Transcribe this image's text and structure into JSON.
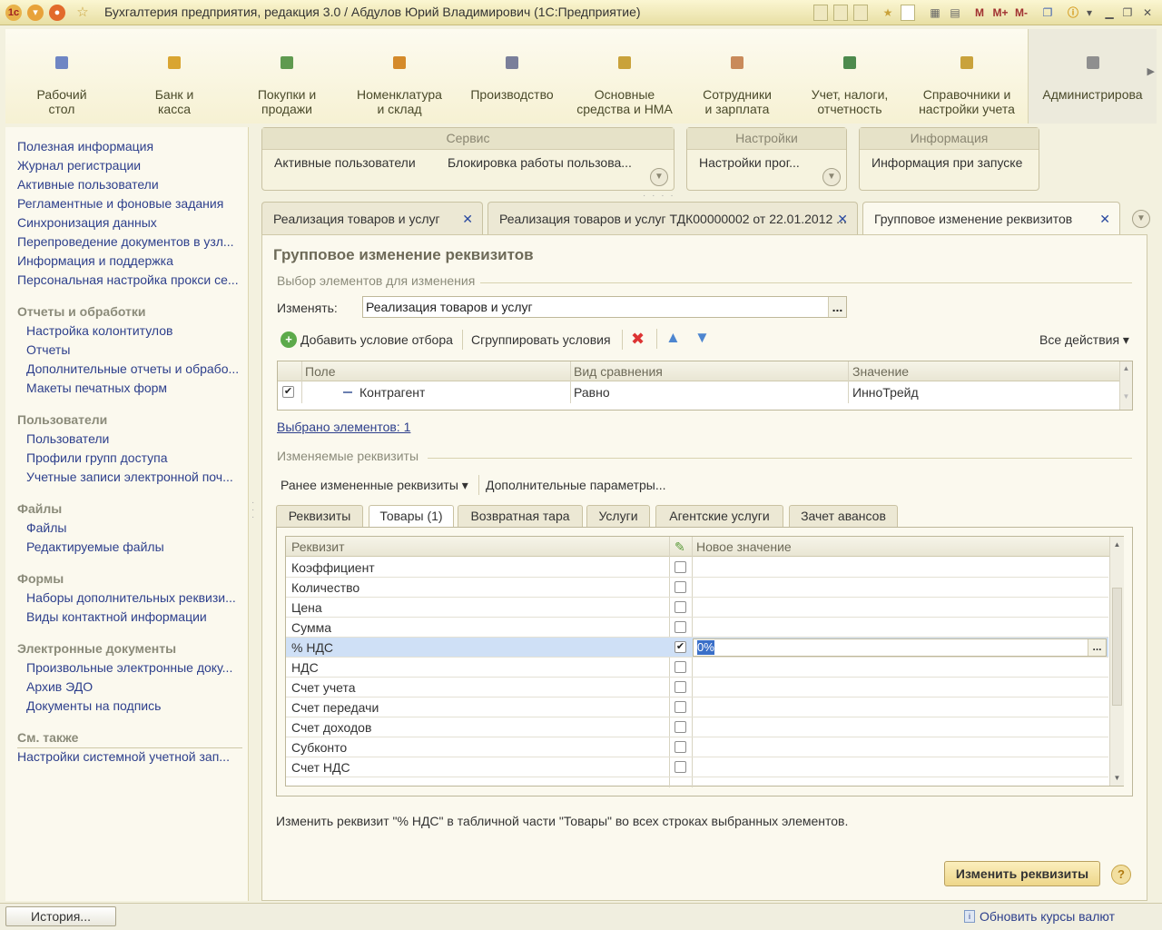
{
  "window": {
    "title": "Бухгалтерия предприятия, редакция 3.0 / Абдулов Юрий Владимирович  (1С:Предприятие)",
    "toolbar_buttons": [
      "M",
      "M+",
      "M-"
    ]
  },
  "sections": [
    {
      "label1": "Рабочий",
      "label2": "стол",
      "icon": "desktop-icon",
      "color": "#6f86c4"
    },
    {
      "label1": "Банк и",
      "label2": "касса",
      "icon": "bank-icon",
      "color": "#d9a531"
    },
    {
      "label1": "Покупки и",
      "label2": "продажи",
      "icon": "cart-icon",
      "color": "#5f9a4f"
    },
    {
      "label1": "Номенклатура",
      "label2": "и склад",
      "icon": "warehouse-icon",
      "color": "#d48a2a"
    },
    {
      "label1": "Производство",
      "label2": "",
      "icon": "factory-icon",
      "color": "#7a7f9a"
    },
    {
      "label1": "Основные",
      "label2": "средства и НМА",
      "icon": "truck-icon",
      "color": "#c9a23b"
    },
    {
      "label1": "Сотрудники",
      "label2": "и зарплата",
      "icon": "people-icon",
      "color": "#c98a5a"
    },
    {
      "label1": "Учет, налоги,",
      "label2": "отчетность",
      "icon": "ledger-icon",
      "color": "#4d8a4d"
    },
    {
      "label1": "Справочники и",
      "label2": "настройки учета",
      "icon": "book-icon",
      "color": "#c9a23b"
    },
    {
      "label1": "Администрирова",
      "label2": "",
      "icon": "gear-icon",
      "color": "#8f8f8f"
    }
  ],
  "left_panel": {
    "links_top": [
      "Полезная информация",
      "Журнал регистрации",
      "Активные пользователи",
      "Регламентные и фоновые задания",
      "Синхронизация данных",
      "Перепроведение документов в узл...",
      "Информация и поддержка",
      "Персональная настройка прокси се..."
    ],
    "groups": [
      {
        "title": "Отчеты и обработки",
        "items": [
          "Настройка колонтитулов",
          "Отчеты",
          "Дополнительные отчеты и обрабо...",
          "Макеты печатных форм"
        ]
      },
      {
        "title": "Пользователи",
        "items": [
          "Пользователи",
          "Профили групп доступа",
          "Учетные записи электронной поч..."
        ]
      },
      {
        "title": "Файлы",
        "items": [
          "Файлы",
          "Редактируемые файлы"
        ]
      },
      {
        "title": "Формы",
        "items": [
          "Наборы дополнительных реквизи...",
          "Виды контактной информации"
        ]
      },
      {
        "title": "Электронные документы",
        "items": [
          "Произвольные электронные доку...",
          "Архив ЭДО",
          "Документы на подпись"
        ]
      }
    ],
    "see_also": {
      "title": "См. также",
      "items": [
        "Настройки системной учетной зап..."
      ]
    }
  },
  "action_groups": [
    {
      "title": "Сервис",
      "items": [
        "Активные пользователи",
        "Блокировка работы пользова..."
      ]
    },
    {
      "title": "Настройки",
      "items": [
        "Настройки прог..."
      ]
    },
    {
      "title": "Информация",
      "items": [
        "Информация при запуске"
      ]
    }
  ],
  "tabs": [
    {
      "label": "Реализация товаров и услуг",
      "close": "✕"
    },
    {
      "label": "Реализация товаров и услуг ТДК00000002 от 22.01.2012 ...",
      "close": "✕"
    },
    {
      "label": "Групповое изменение реквизитов",
      "close": "✕"
    }
  ],
  "form": {
    "title": "Групповое изменение реквизитов",
    "selection_legend": "Выбор элементов для изменения",
    "change_label": "Изменять:",
    "change_value": "Реализация товаров и услуг",
    "ellipsis": "...",
    "add_condition": "Добавить условие отбора",
    "group_conditions": "Сгруппировать условия",
    "all_actions": "Все действия",
    "filter_columns": [
      "Поле",
      "Вид сравнения",
      "Значение"
    ],
    "filter_rows": [
      {
        "checked": true,
        "field": "Контрагент",
        "comparison": "Равно",
        "value": "ИнноТрейд"
      }
    ],
    "selected_link": "Выбрано элементов: 1",
    "changed_legend": "Изменяемые реквизиты",
    "prev_changed": "Ранее измененные реквизиты",
    "extra_params": "Дополнительные параметры...",
    "subtabs": [
      "Реквизиты",
      "Товары (1)",
      "Возвратная тара",
      "Услуги",
      "Агентские услуги",
      "Зачет авансов"
    ],
    "active_subtab": 1,
    "attr_columns": [
      "Реквизит",
      "Новое значение"
    ],
    "attr_rows": [
      {
        "name": "Коэффициент",
        "checked": false,
        "value": ""
      },
      {
        "name": "Количество",
        "checked": false,
        "value": ""
      },
      {
        "name": "Цена",
        "checked": false,
        "value": ""
      },
      {
        "name": "Сумма",
        "checked": false,
        "value": ""
      },
      {
        "name": "% НДС",
        "checked": true,
        "value": "0%",
        "selected": true
      },
      {
        "name": "НДС",
        "checked": false,
        "value": ""
      },
      {
        "name": "Счет учета",
        "checked": false,
        "value": ""
      },
      {
        "name": "Счет передачи",
        "checked": false,
        "value": ""
      },
      {
        "name": "Счет доходов",
        "checked": false,
        "value": ""
      },
      {
        "name": "Субконто",
        "checked": false,
        "value": ""
      },
      {
        "name": "Счет НДС",
        "checked": false,
        "value": ""
      }
    ],
    "hint": "Изменить реквизит \"% НДС\" в табличной части \"Товары\" во всех строках выбранных элементов.",
    "submit": "Изменить реквизиты",
    "help": "?"
  },
  "status": {
    "history": "История...",
    "currency_link": "Обновить курсы валют"
  },
  "colors": {
    "accent": "#2d3f8c",
    "selection": "#cfe0f6",
    "button": "#eed78a"
  }
}
